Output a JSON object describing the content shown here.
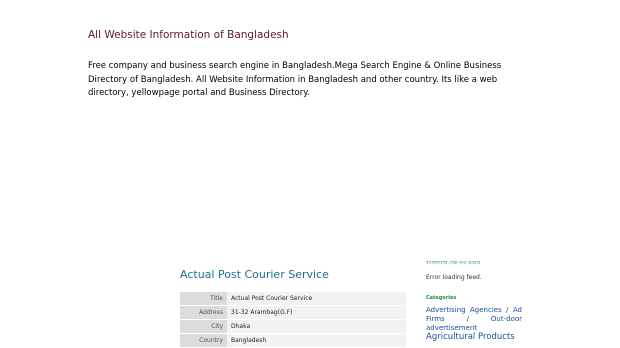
{
  "header": {
    "site_title": "All Website Information of Bangladesh",
    "description": "Free company and business search engine in Bangladesh.Mega Search Engine & Online Business Directory of Bangladesh. All Website Information in Bangladesh and other country. Its like a web directory, yellowpage portal and Business Directory."
  },
  "post": {
    "title": "Actual Post Courier Service",
    "rows": [
      {
        "label": "Title",
        "value": "Actual Post Courier Service"
      },
      {
        "label": "Address",
        "value": "31-32 Arambag(G.F)"
      },
      {
        "label": "City",
        "value": "Dhaka"
      },
      {
        "label": "Country",
        "value": "Bangladesh"
      }
    ]
  },
  "sidebar": {
    "bangla_link": "বাংলাদেশের সেরা তথ্য ভাণ্ডার",
    "feed_error": "Error loading feed.",
    "categories_heading": "Categories",
    "categories": [
      "Advertising Agencies",
      "Ad Firms",
      "Out-door advertisement",
      "Agricultural Products"
    ],
    "separator": "/"
  },
  "colors": {
    "title": "#5a1a3a",
    "post_title": "#1f6e8c",
    "link": "#1a4fa0",
    "label_bg": "#dcdcdc",
    "value_bg": "#f2f2f2"
  }
}
